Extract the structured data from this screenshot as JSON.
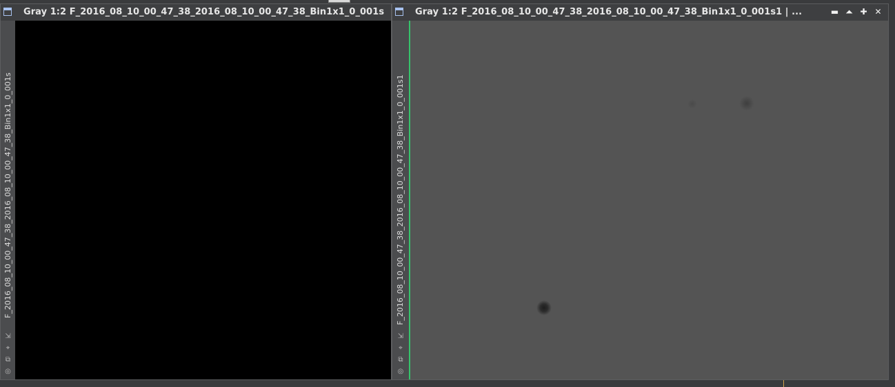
{
  "windows": [
    {
      "title": "Gray 1:2 F_2016_08_10_00_47_38_2016_08_10_00_47_38_Bin1x1_0_001s",
      "side_label": "F_2016_08_10_00_47_38_2016_08_10_00_47_38_Bin1x1_0_001s"
    },
    {
      "title": "Gray 1:2 F_2016_08_10_00_47_38_2016_08_10_00_47_38_Bin1x1_0_001s1 | ...",
      "side_label": "F_2016_08_10_00_47_38_2016_08_10_00_47_38_Bin1x1_0_001s1",
      "buttons": {
        "minimize": "▬",
        "shade": "⏶",
        "maximize": "✚",
        "close": "✕"
      }
    }
  ],
  "side_tools": {
    "fit": "⇲",
    "zoom": "⌖",
    "clone": "⧉",
    "preview": "◎"
  },
  "colors": {
    "active_edge": "#36c26b",
    "title_icon": "#a8c2f0",
    "marker": "#d6a24a"
  }
}
